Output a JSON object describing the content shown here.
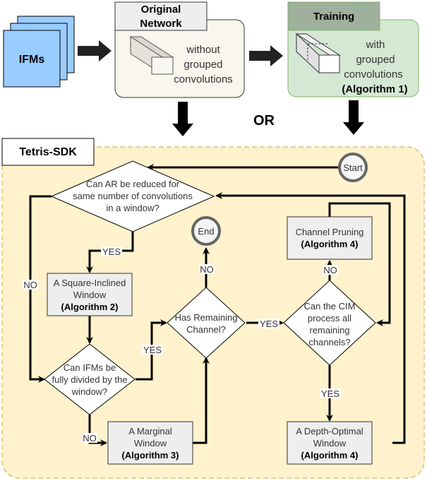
{
  "top": {
    "ifms_label": "IFMs",
    "original_network": {
      "title_line1": "Original",
      "title_line2": "Network",
      "desc": [
        "without",
        "grouped",
        "convolutions"
      ]
    },
    "training": {
      "title": "Training",
      "desc": [
        "with",
        "grouped",
        "convolutions"
      ],
      "algorithm": "(Algorithm 1)"
    },
    "or_label": "OR"
  },
  "sdk": {
    "title": "Tetris-SDK",
    "start": "Start",
    "end": "End",
    "decisions": {
      "reduce_ar": [
        "Can AR be reduced for",
        "same number of convolutions",
        "in a window?"
      ],
      "fully_divided": [
        "Can IFMs be",
        "fully divided by the",
        "window?"
      ],
      "remaining_channel": [
        "Has Remaining",
        "Channel?"
      ],
      "cim_process": [
        "Can the CIM",
        "process all",
        "remaining",
        "channels?"
      ]
    },
    "processes": {
      "square_inclined": {
        "lines": [
          "A Square-Inclined",
          "Window"
        ],
        "algorithm": "(Algorithm 2)"
      },
      "marginal": {
        "lines": [
          "A Marginal",
          "Window"
        ],
        "algorithm": "(Algorithm 3)"
      },
      "depth_optimal": {
        "lines": [
          "A Depth-Optimal",
          "Window"
        ],
        "algorithm": "(Algorithm 4)"
      },
      "channel_pruning": {
        "lines": [
          "Channel Pruning"
        ],
        "algorithm": "(Algorithm 4)"
      }
    },
    "edge_labels": {
      "reduce_yes": "YES",
      "reduce_no": "NO",
      "divided_yes": "YES",
      "divided_no": "NO",
      "remaining_no": "NO",
      "remaining_yes": "YES",
      "cim_no": "NO",
      "cim_yes": "YES"
    }
  },
  "colors": {
    "ifms_fill": "#99ccff",
    "original_fill": "#f9f7ed",
    "training_fill": "#d5e8d4",
    "training_header": "#9fb09d",
    "sdk_fill": "#fff2cc",
    "sdk_border": "#d6b656",
    "process_fill": "#eeeeee"
  }
}
